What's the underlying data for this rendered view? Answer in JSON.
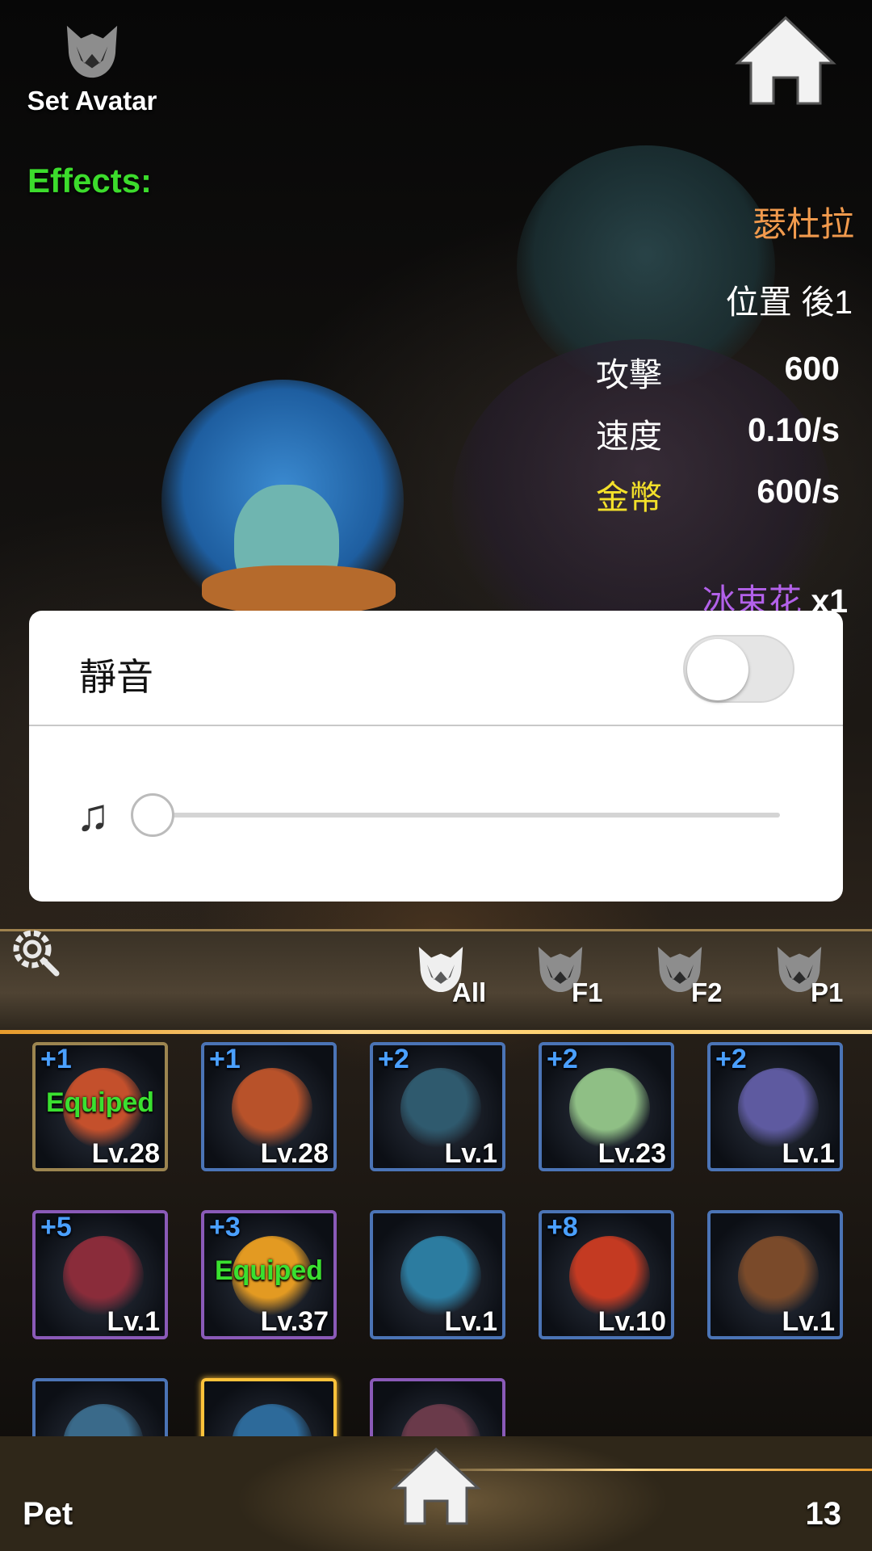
{
  "header": {
    "set_avatar_label": "Set Avatar",
    "effects_label": "Effects:"
  },
  "pet_info": {
    "name": "瑟杜拉",
    "position": "位置 後1",
    "stats": [
      {
        "label": "攻擊",
        "value": "600",
        "color": "#ffffff"
      },
      {
        "label": "速度",
        "value": "0.10/s",
        "color": "#ffffff"
      },
      {
        "label": "金幣",
        "value": "600/s",
        "color": "#f3e02a"
      }
    ],
    "skill_name": "冰束花",
    "skill_count": "x1",
    "name_color": "#f19a4d",
    "skill_color": "#b361ea"
  },
  "settings_modal": {
    "mute_label": "靜音",
    "mute_on": false,
    "music_icon": "♫",
    "volume": 0
  },
  "filter_tabs": [
    {
      "label": "All",
      "icon": "wolf-emblem-icon",
      "active": true
    },
    {
      "label": "F1",
      "icon": "wolf-emblem-icon",
      "active": false
    },
    {
      "label": "F2",
      "icon": "wolf-emblem-icon",
      "active": false
    },
    {
      "label": "P1",
      "icon": "wolf-emblem-icon",
      "active": false
    }
  ],
  "pets": [
    {
      "plus": "+1",
      "level": "Lv.28",
      "equipped": "Equiped",
      "frame": "gold",
      "color": "#c4502c"
    },
    {
      "plus": "+1",
      "level": "Lv.28",
      "equipped": "",
      "frame": "blue",
      "color": "#b8522a"
    },
    {
      "plus": "+2",
      "level": "Lv.1",
      "equipped": "",
      "frame": "blue",
      "color": "#2f5a6e"
    },
    {
      "plus": "+2",
      "level": "Lv.23",
      "equipped": "",
      "frame": "blue",
      "color": "#8fbf85"
    },
    {
      "plus": "+2",
      "level": "Lv.1",
      "equipped": "",
      "frame": "blue",
      "color": "#5e5aa0"
    },
    {
      "plus": "+5",
      "level": "Lv.1",
      "equipped": "",
      "frame": "purple",
      "color": "#8a2c3a"
    },
    {
      "plus": "+3",
      "level": "Lv.37",
      "equipped": "Equiped",
      "frame": "purple",
      "color": "#e39a22"
    },
    {
      "plus": "",
      "level": "Lv.1",
      "equipped": "",
      "frame": "blue",
      "color": "#2c7ca0"
    },
    {
      "plus": "+8",
      "level": "Lv.10",
      "equipped": "",
      "frame": "blue",
      "color": "#c43a22"
    },
    {
      "plus": "",
      "level": "Lv.1",
      "equipped": "",
      "frame": "blue",
      "color": "#7a4a2a"
    },
    {
      "plus": "",
      "level": "",
      "equipped": "",
      "frame": "blue",
      "color": "#3a6a8a"
    },
    {
      "plus": "",
      "level": "",
      "equipped": "",
      "frame": "selected",
      "color": "#2d6a9a"
    },
    {
      "plus": "",
      "level": "",
      "equipped": "",
      "frame": "purple",
      "color": "#6a3a4a"
    }
  ],
  "footer": {
    "section_label": "Pet",
    "count": "13"
  }
}
